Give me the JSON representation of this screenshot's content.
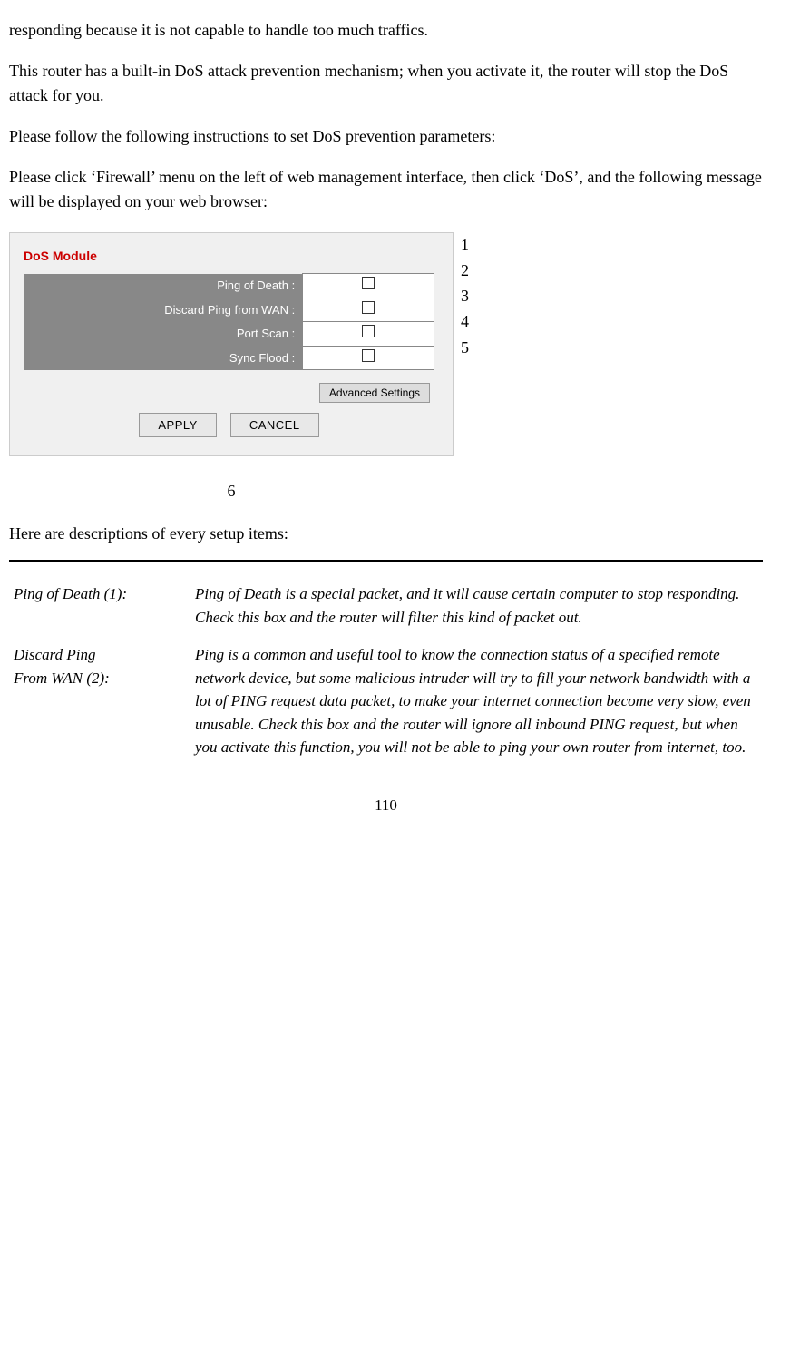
{
  "intro": {
    "para1": "responding because it is not capable to handle too much traffics.",
    "para2": "This router has a built-in DoS attack prevention mechanism; when you activate it, the router will stop the DoS attack for you.",
    "para3": "Please follow the following instructions to set DoS prevention parameters:",
    "para4": "Please click ‘Firewall’ menu on the left of web management interface, then click ‘DoS’, and the following message will be displayed on your web browser:"
  },
  "dos_module": {
    "title": "DoS Module",
    "rows": [
      {
        "label": "Ping of Death :",
        "num": "1"
      },
      {
        "label": "Discard Ping from WAN :",
        "num": "2"
      },
      {
        "label": "Port Scan :",
        "num": "3"
      },
      {
        "label": "Sync Flood :",
        "num": "4"
      }
    ],
    "advanced_btn": "Advanced Settings",
    "advanced_num": "5",
    "apply_btn": "APPLY",
    "cancel_btn": "CANCEL",
    "buttons_num": "6"
  },
  "descriptions": {
    "intro": "Here are descriptions of every setup items:",
    "items": [
      {
        "label": "Ping of Death (1):",
        "text": "Ping of Death is a special packet, and it will cause certain computer to stop responding. Check this box and the router will filter this kind of packet out."
      },
      {
        "label": "Discard Ping\nFrom WAN (2):",
        "text": "Ping is a common and useful tool to know the connection status of a specified remote network device, but some malicious intruder will try to fill your network bandwidth with a lot of PING request data packet, to make your internet connection become very slow, even unusable. Check this box and the router will ignore all inbound PING request, but when you activate this function, you will not be able to ping your own router from internet, too."
      }
    ]
  },
  "page_number": "110"
}
